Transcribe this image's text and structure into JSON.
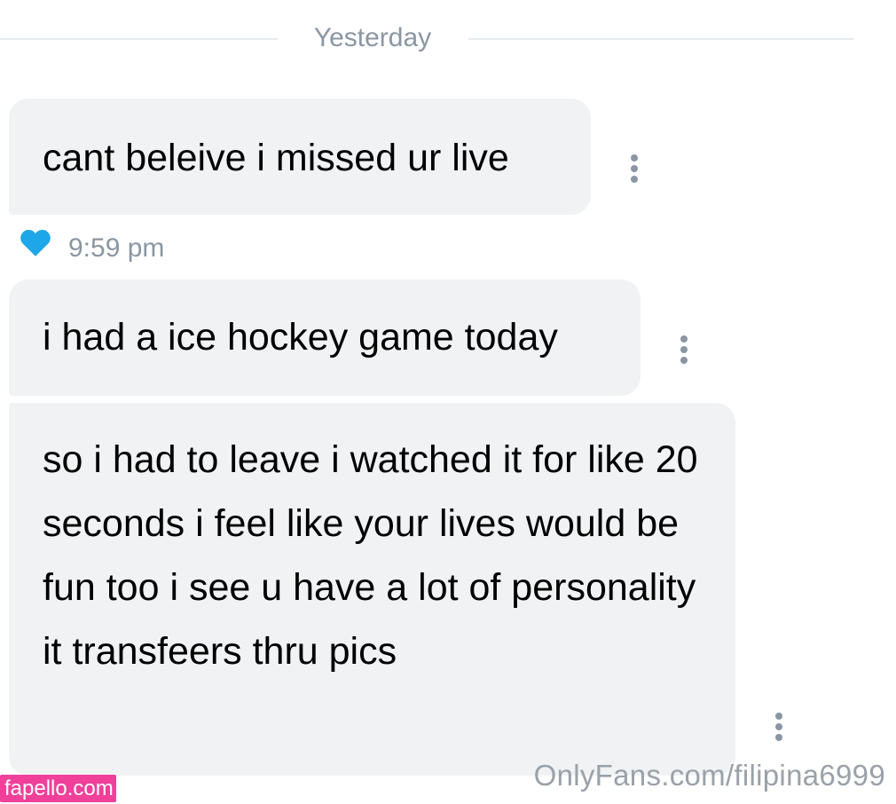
{
  "divider": {
    "label": "Yesterday"
  },
  "messages": [
    {
      "text": "cant beleive i missed ur live"
    },
    {
      "text": "i had a ice hockey game today"
    },
    {
      "text": "so i had to leave i watched it for like 20 seconds i feel like your lives would be fun too i see u have a lot of personality it transfeers thru pics"
    }
  ],
  "meta": {
    "time": "9:59 pm",
    "like_icon": "heart-icon",
    "more_icon": "more-vertical-icon"
  },
  "watermarks": {
    "left": "fapello.com",
    "right": "OnlyFans.com/filipina6999"
  },
  "colors": {
    "bubble": "#f0f2f3",
    "muted_text": "#8a96a3",
    "heart": "#1ea7e8",
    "watermark_badge": "#f0409a"
  }
}
